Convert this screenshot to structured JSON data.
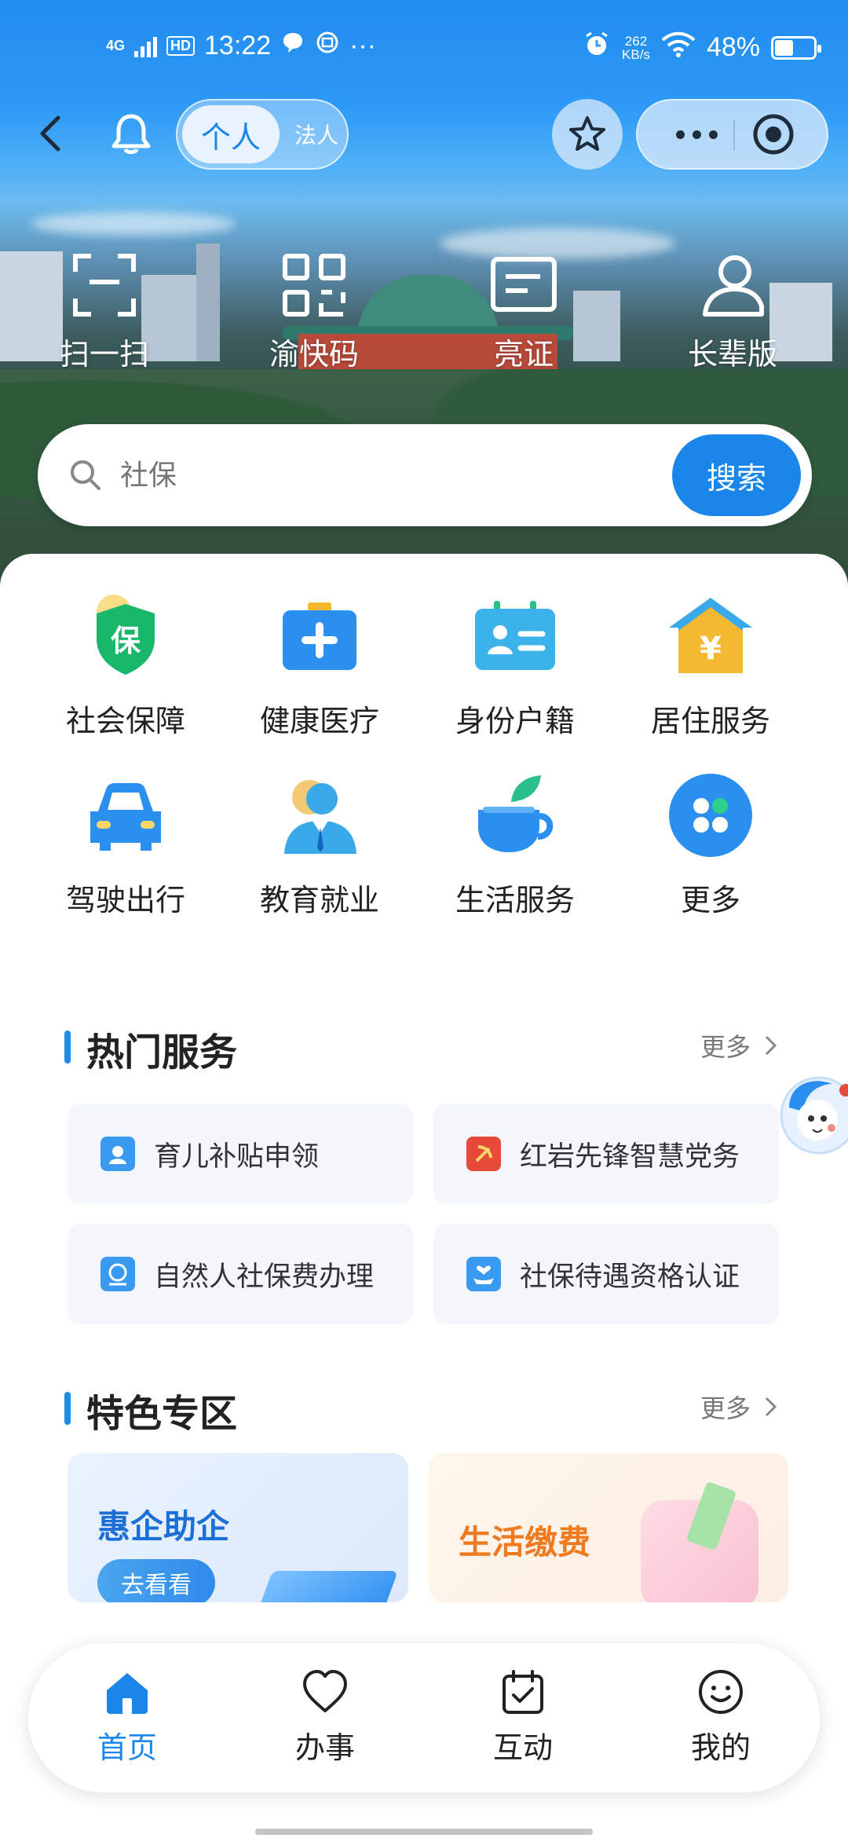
{
  "status_bar": {
    "network": "4G",
    "hd": "HD",
    "time": "13:22",
    "more": "···",
    "net_speed_value": "262",
    "net_speed_unit": "KB/s",
    "battery": "48%",
    "battery_level": 0.48
  },
  "nav": {
    "role_personal": "个人",
    "role_legal": "法人"
  },
  "quick_actions": [
    {
      "label": "扫一扫",
      "icon": "scan-icon"
    },
    {
      "label": "渝快码",
      "icon": "qr-code-icon"
    },
    {
      "label": "亮证",
      "icon": "id-card-icon"
    },
    {
      "label": "长辈版",
      "icon": "elder-user-icon"
    }
  ],
  "search": {
    "placeholder": "社保",
    "button": "搜索"
  },
  "services": [
    {
      "label": "社会保障",
      "icon": "social-security-icon",
      "color": "#18b86a"
    },
    {
      "label": "健康医疗",
      "icon": "medical-kit-icon",
      "color": "#2b8ff0"
    },
    {
      "label": "身份户籍",
      "icon": "identity-card-icon",
      "color": "#3bb3ea"
    },
    {
      "label": "居住服务",
      "icon": "house-yuan-icon",
      "color": "#f4b930"
    },
    {
      "label": "驾驶出行",
      "icon": "car-icon",
      "color": "#2a90f0"
    },
    {
      "label": "教育就业",
      "icon": "graduate-person-icon",
      "color": "#3aa9ea"
    },
    {
      "label": "生活服务",
      "icon": "teacup-icon",
      "color": "#2b8ff0"
    },
    {
      "label": "更多",
      "icon": "more-apps-icon",
      "color": "#2b8ff0"
    }
  ],
  "hot_services": {
    "title": "热门服务",
    "more": "更多",
    "items": [
      {
        "label": "育儿补贴申领",
        "icon": "child-subsidy-icon"
      },
      {
        "label": "红岩先锋智慧党务",
        "icon": "party-emblem-icon"
      },
      {
        "label": "自然人社保费办理",
        "icon": "social-fee-icon"
      },
      {
        "label": "社保待遇资格认证",
        "icon": "hand-heart-icon"
      }
    ]
  },
  "features": {
    "title": "特色专区",
    "more": "更多",
    "cards": [
      {
        "title": "惠企助企",
        "button": "去看看"
      },
      {
        "title": "生活缴费"
      }
    ]
  },
  "tabbar": [
    {
      "label": "首页",
      "icon": "home-icon",
      "active": true
    },
    {
      "label": "办事",
      "icon": "heart-icon",
      "active": false
    },
    {
      "label": "互动",
      "icon": "calendar-check-icon",
      "active": false
    },
    {
      "label": "我的",
      "icon": "smile-icon",
      "active": false
    }
  ],
  "colors": {
    "accent": "#1b86ea",
    "card_bg": "#f3f7fc"
  }
}
